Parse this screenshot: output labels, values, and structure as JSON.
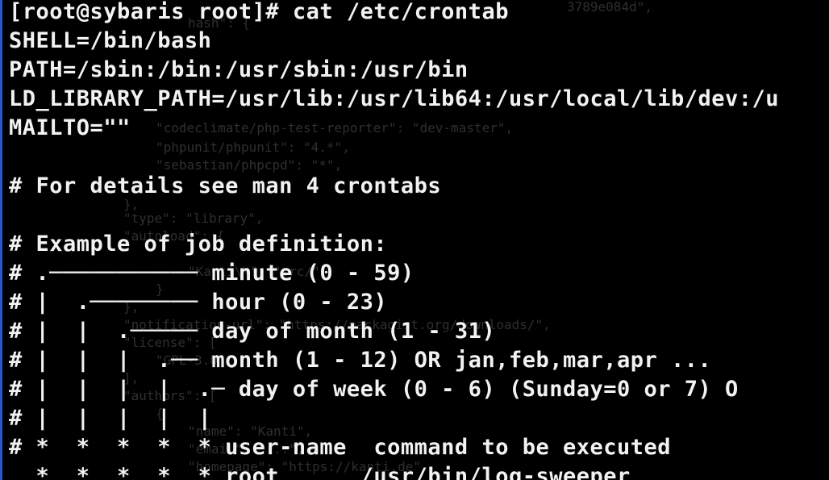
{
  "terminal": {
    "prompt": "[root@sybaris root]# cat /etc/crontab",
    "lines": [
      "SHELL=/bin/bash",
      "PATH=/sbin:/bin:/usr/sbin:/usr/bin",
      "LD_LIBRARY_PATH=/usr/lib:/usr/lib64:/usr/local/lib/dev:/u",
      "MAILTO=\"\"",
      "",
      "# For details see man 4 crontabs",
      "",
      "# Example of job definition:",
      "# .─────────── minute (0 - 59)",
      "# |  .──────── hour (0 - 23)",
      "# |  |  .───── day of month (1 - 31)",
      "# |  |  |  .── month (1 - 12) OR jan,feb,mar,apr ...",
      "# |  |  |  |  .─ day of week (0 - 6) (Sunday=0 or 7) O",
      "# |  |  |  |  |",
      "# *  *  *  *  * user-name  command to be executed",
      "  *  *  *  *  * root      /usr/bin/log-sweeper"
    ],
    "background_ghost_text": [
      "3789e084d\",",
      "hash\": {",
      "\"codeclimate/php-test-reporter\": \"dev-master\",",
      "\"phpunit/phpunit\": \"4.*\",",
      "\"sebastian/phpcpd\": \"*\",",
      "},",
      "\"type\": \"library\",",
      "\"autoload\": {",
      "\"Kanti\\\\\": \"src/\"",
      "}",
      "},",
      "\"notification-url\": \"https://packagist.org/downloads/\",",
      "\"license\": [",
      "\"GPL-3.0\"",
      "],",
      "\"authors\": [",
      "{",
      "\"name\": \"Kanti\",",
      "\"email\": \"...\",",
      "\"homepage\": \"https://kanti.de\""
    ]
  }
}
